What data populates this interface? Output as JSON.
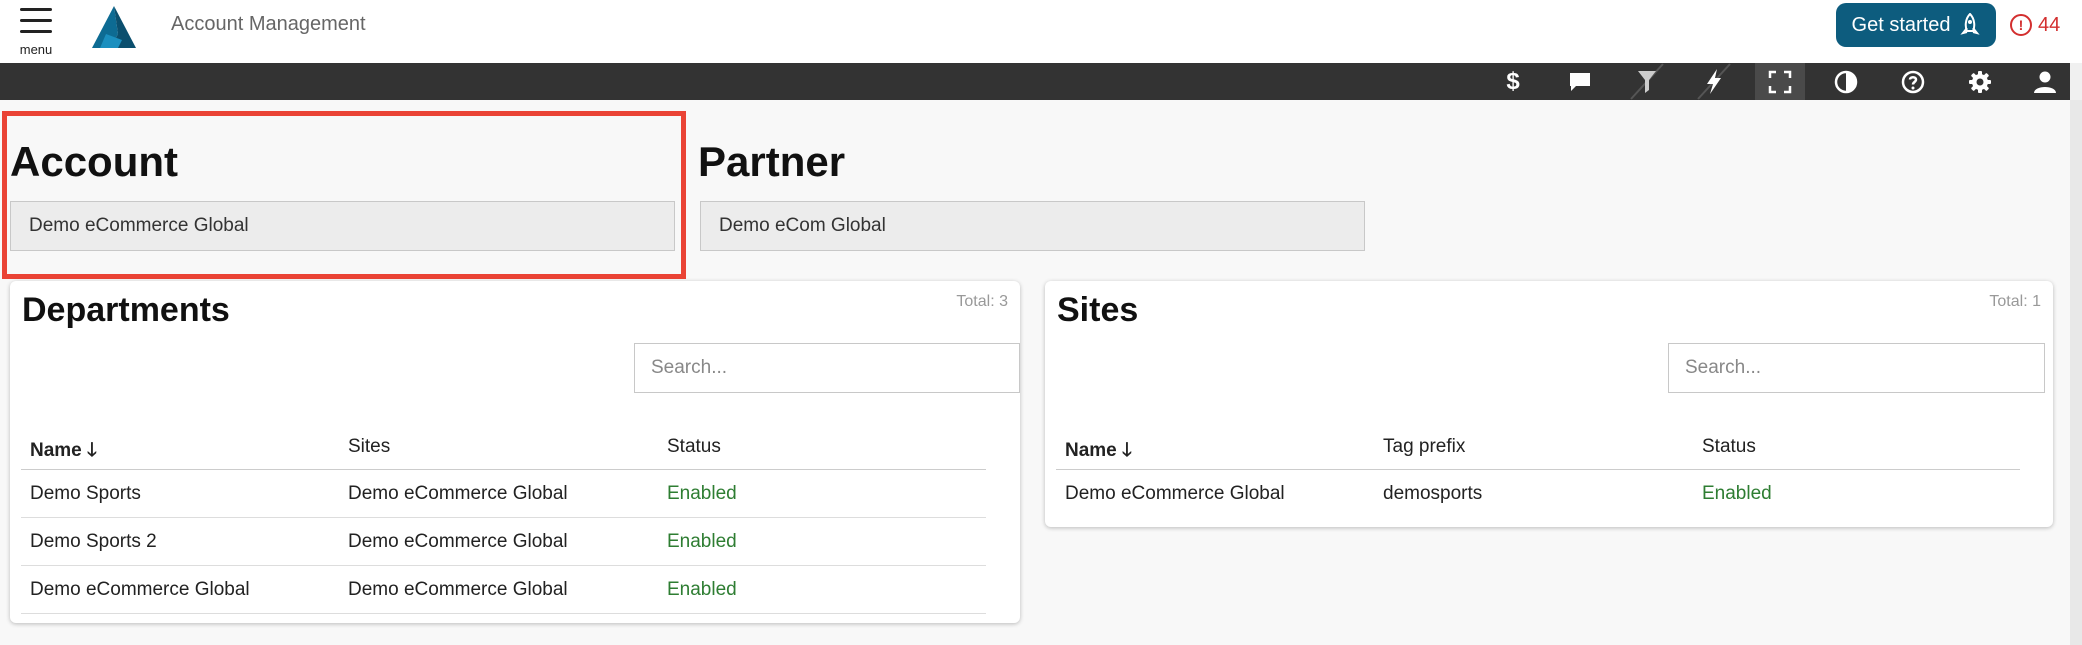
{
  "header": {
    "menu_label": "menu",
    "app_title": "Account Management",
    "get_started_label": "Get started",
    "alert_count": "44",
    "alert_glyph": "!"
  },
  "toolbar": {
    "icons": [
      "dollar-icon",
      "chat-icon",
      "filter-icon",
      "lightning-icon",
      "fullscreen-icon",
      "contrast-icon",
      "help-icon",
      "settings-icon",
      "user-icon"
    ],
    "dollar_glyph": "$"
  },
  "account": {
    "title": "Account",
    "value": "Demo eCommerce Global"
  },
  "partner": {
    "title": "Partner",
    "value": "Demo eCom Global"
  },
  "departments": {
    "title": "Departments",
    "total": "Total: 3",
    "search_placeholder": "Search...",
    "columns": [
      "Name",
      "Sites",
      "Status"
    ],
    "sort_arrow": "🡓",
    "rows": [
      {
        "name": "Demo Sports",
        "sites": "Demo eCommerce Global",
        "status": "Enabled"
      },
      {
        "name": "Demo Sports 2",
        "sites": "Demo eCommerce Global",
        "status": "Enabled"
      },
      {
        "name": "Demo eCommerce Global",
        "sites": "Demo eCommerce Global",
        "status": "Enabled"
      }
    ]
  },
  "sites": {
    "title": "Sites",
    "total": "Total: 1",
    "search_placeholder": "Search...",
    "columns": [
      "Name",
      "Tag prefix",
      "Status"
    ],
    "sort_arrow": "🡓",
    "rows": [
      {
        "name": "Demo eCommerce Global",
        "tag_prefix": "demosports",
        "status": "Enabled"
      }
    ]
  },
  "colors": {
    "brand": "#0d5c7e",
    "toolbar_bg": "#333333",
    "status_enabled": "#2e7d32",
    "alert": "#d32f2f",
    "highlight": "#ea4335"
  }
}
